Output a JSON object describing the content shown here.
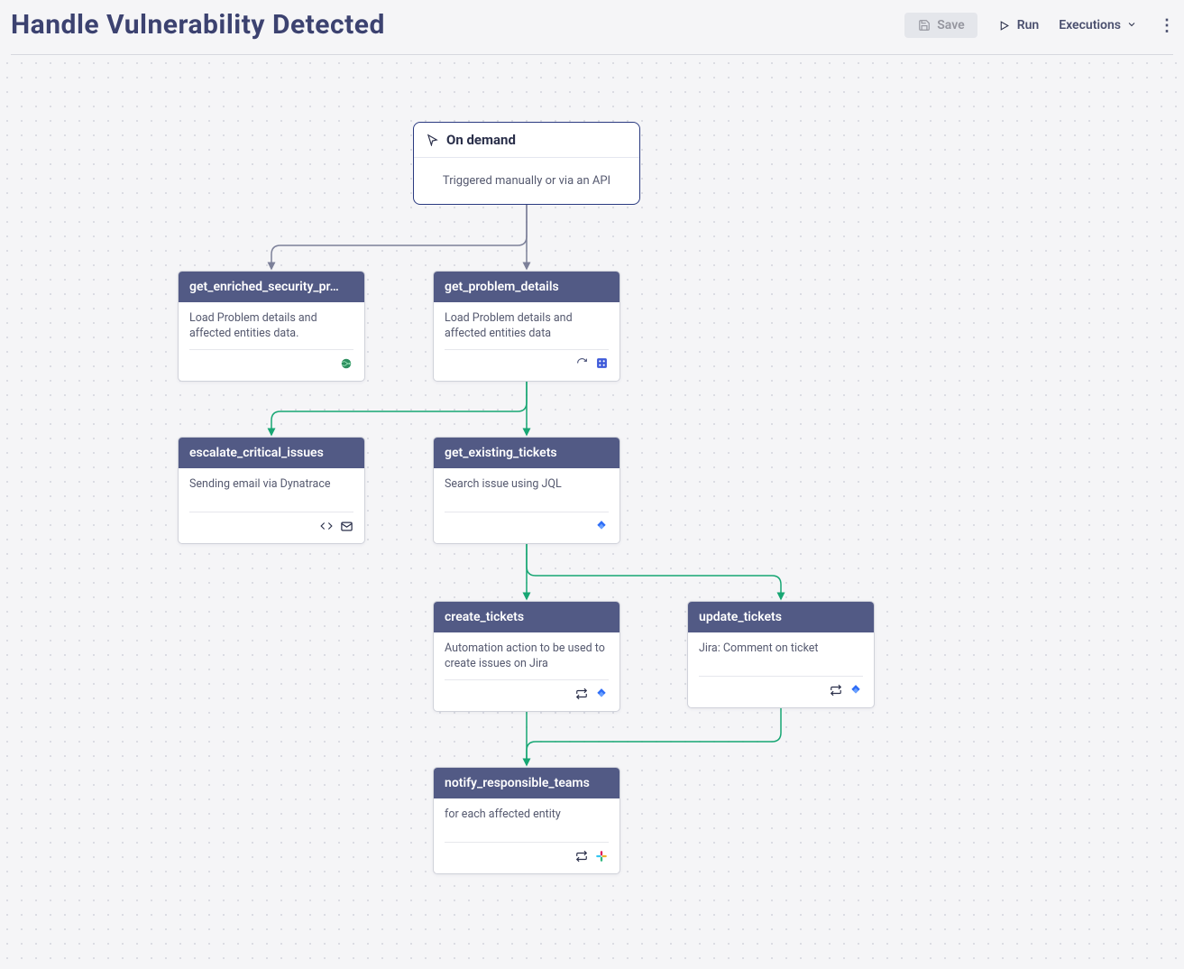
{
  "header": {
    "title": "Handle Vulnerability Detected",
    "save_label": "Save",
    "run_label": "Run",
    "executions_label": "Executions"
  },
  "trigger": {
    "title": "On demand",
    "body": "Triggered manually or via an API"
  },
  "nodes": {
    "get_enriched_security_pr": {
      "title": "get_enriched_security_pr…",
      "body": "Load Problem details and affected entities data.",
      "foot_icons": [
        "globe"
      ]
    },
    "get_problem_details": {
      "title": "get_problem_details",
      "body": "Load Problem details and affected entities data",
      "foot_icons": [
        "refresh",
        "app"
      ]
    },
    "escalate_critical_issues": {
      "title": "escalate_critical_issues",
      "body": "Sending email via Dynatrace",
      "foot_icons": [
        "code",
        "mail"
      ]
    },
    "get_existing_tickets": {
      "title": "get_existing_tickets",
      "body": "Search issue using JQL",
      "foot_icons": [
        "jira"
      ]
    },
    "create_tickets": {
      "title": "create_tickets",
      "body": "Automation action to be used to create issues on Jira",
      "foot_icons": [
        "loop",
        "jira"
      ]
    },
    "update_tickets": {
      "title": "update_tickets",
      "body": "Jira: Comment on ticket",
      "foot_icons": [
        "loop",
        "jira"
      ]
    },
    "notify_responsible_teams": {
      "title": "notify_responsible_teams",
      "body": "for each affected entity",
      "foot_icons": [
        "loop",
        "slack"
      ]
    }
  }
}
